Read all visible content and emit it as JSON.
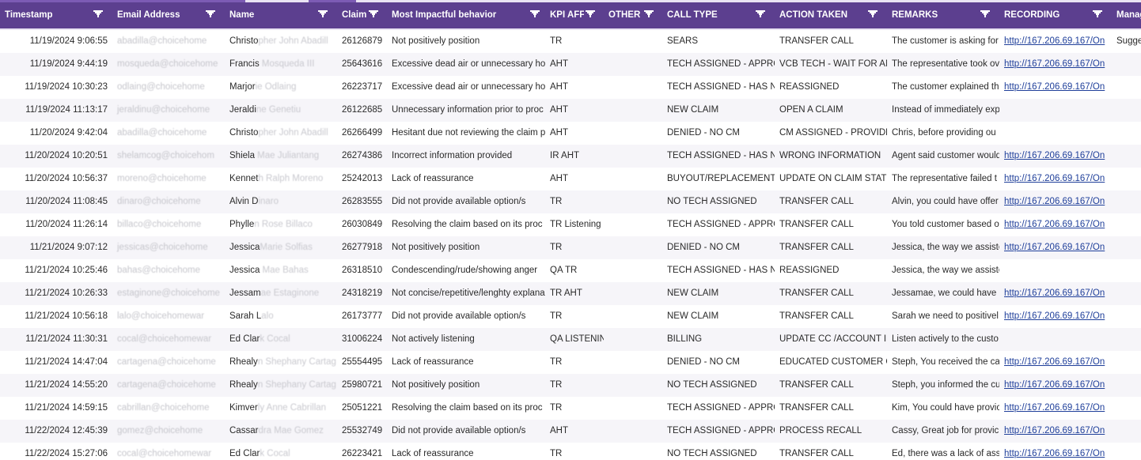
{
  "headers": [
    {
      "key": "timestamp",
      "label": "Timestamp"
    },
    {
      "key": "email",
      "label": "Email Address"
    },
    {
      "key": "name",
      "label": "Name"
    },
    {
      "key": "claim",
      "label": "Claim"
    },
    {
      "key": "behavior",
      "label": "Most Impactful behavior"
    },
    {
      "key": "kpi",
      "label": "KPI AFFE"
    },
    {
      "key": "other",
      "label": "OTHER K"
    },
    {
      "key": "calltype",
      "label": "CALL TYPE"
    },
    {
      "key": "action",
      "label": "ACTION TAKEN"
    },
    {
      "key": "remarks",
      "label": "REMARKS"
    },
    {
      "key": "recording",
      "label": "RECORDING"
    },
    {
      "key": "manager",
      "label": "Manag"
    }
  ],
  "rows": [
    {
      "timestamp": "11/19/2024 9:06:55",
      "email": "abadilla@choicehome",
      "name": "Christo",
      "name_rest": "pher John Abadill",
      "claim": "26126879",
      "behavior": "Not positively position",
      "kpi": "TR",
      "other": "",
      "calltype": "SEARS",
      "action": "TRANSFER CALL",
      "remarks": "The customer is asking for",
      "recording": "http://167.206.69.167/On",
      "manager": "Sugges"
    },
    {
      "timestamp": "11/19/2024 9:44:19",
      "email": "mosqueda@choicehome",
      "name": "Francis",
      "name_rest": " Mosqueda III",
      "claim": "25643616",
      "behavior": "Excessive dead air or unnecessary ho",
      "kpi": "AHT",
      "other": "",
      "calltype": "TECH ASSIGNED - APPROVE",
      "action": "VCB TECH - WAIT FOR ANSW",
      "remarks": "The representative took ov",
      "recording": "http://167.206.69.167/On",
      "manager": ""
    },
    {
      "timestamp": "11/19/2024 10:30:23",
      "email": "odlaing@choicehome",
      "name": "Marjor",
      "name_rest": "ie Odlaing",
      "claim": "26223717",
      "behavior": "Excessive dead air or unnecessary ho",
      "kpi": "AHT",
      "other": "",
      "calltype": "TECH ASSIGNED - HAS NOT",
      "action": "REASSIGNED",
      "remarks": "The customer explained th",
      "recording": "http://167.206.69.167/On",
      "manager": ""
    },
    {
      "timestamp": "11/19/2024 11:13:17",
      "email": "jeraldinu@choicehome",
      "name": "Jeraldi",
      "name_rest": "ne Genetiu",
      "claim": "26122685",
      "behavior": "Unnecessary information prior to proc",
      "kpi": "AHT",
      "other": "",
      "calltype": "NEW CLAIM",
      "action": "OPEN A CLAIM",
      "remarks": "Instead of immediately exp",
      "recording": "",
      "manager": ""
    },
    {
      "timestamp": "11/20/2024 9:42:04",
      "email": "abadilla@choicehome",
      "name": "Christo",
      "name_rest": "pher John Abadill",
      "claim": "26266499",
      "behavior": "Hesitant due not reviewing the claim p",
      "kpi": "AHT",
      "other": "",
      "calltype": "DENIED - NO CM",
      "action": "CM ASSIGNED - PROVIDE IN",
      "remarks": "Chris, before providing ou",
      "recording": "",
      "manager": ""
    },
    {
      "timestamp": "11/20/2024 10:20:51",
      "email": "shelamcog@choicehom",
      "name": "Shiela",
      "name_rest": " Mae Juliantang",
      "claim": "26274386",
      "behavior": "Incorrect information provided",
      "kpi": "IR AHT",
      "other": "",
      "calltype": "TECH ASSIGNED - HAS NOT",
      "action": "WRONG INFORMATION",
      "remarks": "Agent said customer would",
      "recording": "http://167.206.69.167/On",
      "manager": ""
    },
    {
      "timestamp": "11/20/2024 10:56:37",
      "email": "moreno@choicehome",
      "name": "Kennet",
      "name_rest": "h Ralph Moreno",
      "claim": "25242013",
      "behavior": "Lack of reassurance",
      "kpi": "AHT",
      "other": "",
      "calltype": "BUYOUT/REPLACEMENT",
      "action": "UPDATE ON CLAIM STATUS",
      "remarks": "The representative failed t",
      "recording": "http://167.206.69.167/On",
      "manager": ""
    },
    {
      "timestamp": "11/20/2024 11:08:45",
      "email": "dinaro@choicehome",
      "name": "Alvin D",
      "name_rest": "inaro",
      "claim": "26283555",
      "behavior": "Did not provide available option/s",
      "kpi": "TR",
      "other": "",
      "calltype": "NO TECH ASSIGNED",
      "action": "TRANSFER CALL",
      "remarks": "Alvin, you could have offer",
      "recording": "http://167.206.69.167/On",
      "manager": ""
    },
    {
      "timestamp": "11/20/2024 11:26:14",
      "email": "billaco@choicehome",
      "name": "Phylle",
      "name_rest": "n Rose Billaco",
      "claim": "26030849",
      "behavior": "Resolving the claim based on its proc",
      "kpi": "TR Listening",
      "other": "",
      "calltype": "TECH ASSIGNED - APPROVE",
      "action": "TRANSFER CALL",
      "remarks": "You told customer based o",
      "recording": "http://167.206.69.167/On",
      "manager": ""
    },
    {
      "timestamp": "11/21/2024 9:07:12",
      "email": "jessicas@choicehome",
      "name": "Jessica",
      "name_rest": "Marie Solfias",
      "claim": "26277918",
      "behavior": "Not positively position",
      "kpi": "TR",
      "other": "",
      "calltype": "DENIED - NO CM",
      "action": "TRANSFER CALL",
      "remarks": "Jessica, the way we assiste",
      "recording": "http://167.206.69.167/On",
      "manager": ""
    },
    {
      "timestamp": "11/21/2024 10:25:46",
      "email": "bahas@choicehome",
      "name": "Jessica",
      "name_rest": " Mae Bahas",
      "claim": "26318510",
      "behavior": "Condescending/rude/showing anger",
      "kpi": "QA TR",
      "other": "",
      "calltype": "TECH ASSIGNED - HAS NOT",
      "action": "REASSIGNED",
      "remarks": "Jessica, the way we assiste",
      "recording": "",
      "manager": ""
    },
    {
      "timestamp": "11/21/2024 10:26:33",
      "email": "estaginone@choicehome",
      "name": "Jessam",
      "name_rest": "ae Estaginone",
      "claim": "24318219",
      "behavior": "Not concise/repetitive/lenghty explana",
      "kpi": "TR AHT",
      "other": "",
      "calltype": "NEW CLAIM",
      "action": "TRANSFER CALL",
      "remarks": "Jessamae, we could have o",
      "recording": "http://167.206.69.167/On",
      "manager": ""
    },
    {
      "timestamp": "11/21/2024 10:56:18",
      "email": "lalo@choicehomewar",
      "name": "Sarah L",
      "name_rest": "alo",
      "claim": "26173777",
      "behavior": "Did not provide available option/s",
      "kpi": "TR",
      "other": "",
      "calltype": "NEW CLAIM",
      "action": "TRANSFER CALL",
      "remarks": "Sarah we need to positivel",
      "recording": "http://167.206.69.167/On",
      "manager": ""
    },
    {
      "timestamp": "11/21/2024 11:30:31",
      "email": "cocal@choicehomewar",
      "name": "Ed Clar",
      "name_rest": "k Cocal",
      "claim": "31006224",
      "behavior": "Not actively listening",
      "kpi": "QA LISTENING",
      "other": "",
      "calltype": "BILLING",
      "action": "UPDATE CC /ACCOUNT INFO",
      "remarks": "Listen actively to the custo",
      "recording": "",
      "manager": ""
    },
    {
      "timestamp": "11/21/2024 14:47:04",
      "email": "cartagena@choicehome",
      "name": "Rhealy",
      "name_rest": "n Shephany Cartag",
      "claim": "25554495",
      "behavior": "Lack of reassurance",
      "kpi": "TR",
      "other": "",
      "calltype": "DENIED - NO CM",
      "action": "EDUCATED CUSTOMER ON C",
      "remarks": "Steph, You received the cal",
      "recording": "http://167.206.69.167/On",
      "manager": ""
    },
    {
      "timestamp": "11/21/2024 14:55:20",
      "email": "cartagena@choicehome",
      "name": "Rhealy",
      "name_rest": "n Shephany Cartag",
      "claim": "25980721",
      "behavior": "Not positively position",
      "kpi": "TR",
      "other": "",
      "calltype": "NO TECH ASSIGNED",
      "action": "TRANSFER CALL",
      "remarks": "Steph, you informed the cu",
      "recording": "http://167.206.69.167/On",
      "manager": ""
    },
    {
      "timestamp": "11/21/2024 14:59:15",
      "email": "cabrillan@choicehome",
      "name": "Kimver",
      "name_rest": "ly Anne Cabrillan",
      "claim": "25051221",
      "behavior": "Resolving the claim based on its proc",
      "kpi": "TR",
      "other": "",
      "calltype": "TECH ASSIGNED - APPROVE",
      "action": "TRANSFER CALL",
      "remarks": "Kim, You could have provic",
      "recording": "http://167.206.69.167/On",
      "manager": ""
    },
    {
      "timestamp": "11/22/2024 12:45:39",
      "email": "gomez@choicehome",
      "name": "Cassar",
      "name_rest": "dra Mae Gomez",
      "claim": "25532749",
      "behavior": "Did not provide available option/s",
      "kpi": "AHT",
      "other": "",
      "calltype": "TECH ASSIGNED - APPROVE",
      "action": "PROCESS RECALL",
      "remarks": "Cassy, Great job for provic",
      "recording": "http://167.206.69.167/On",
      "manager": ""
    },
    {
      "timestamp": "11/22/2024 15:27:06",
      "email": "cocal@choicehomewar",
      "name": "Ed Clar",
      "name_rest": "k Cocal",
      "claim": "26223421",
      "behavior": "Lack of reassurance",
      "kpi": "TR",
      "other": "",
      "calltype": "NO TECH ASSIGNED",
      "action": "TRANSFER CALL",
      "remarks": "Ed, there was a lack of ass",
      "recording": "http://167.206.69.167/On",
      "manager": ""
    }
  ],
  "colors": {
    "header_bg": "#5c3f8f",
    "link": "#1f3f9a",
    "alt_row": "#f6f5f9"
  }
}
